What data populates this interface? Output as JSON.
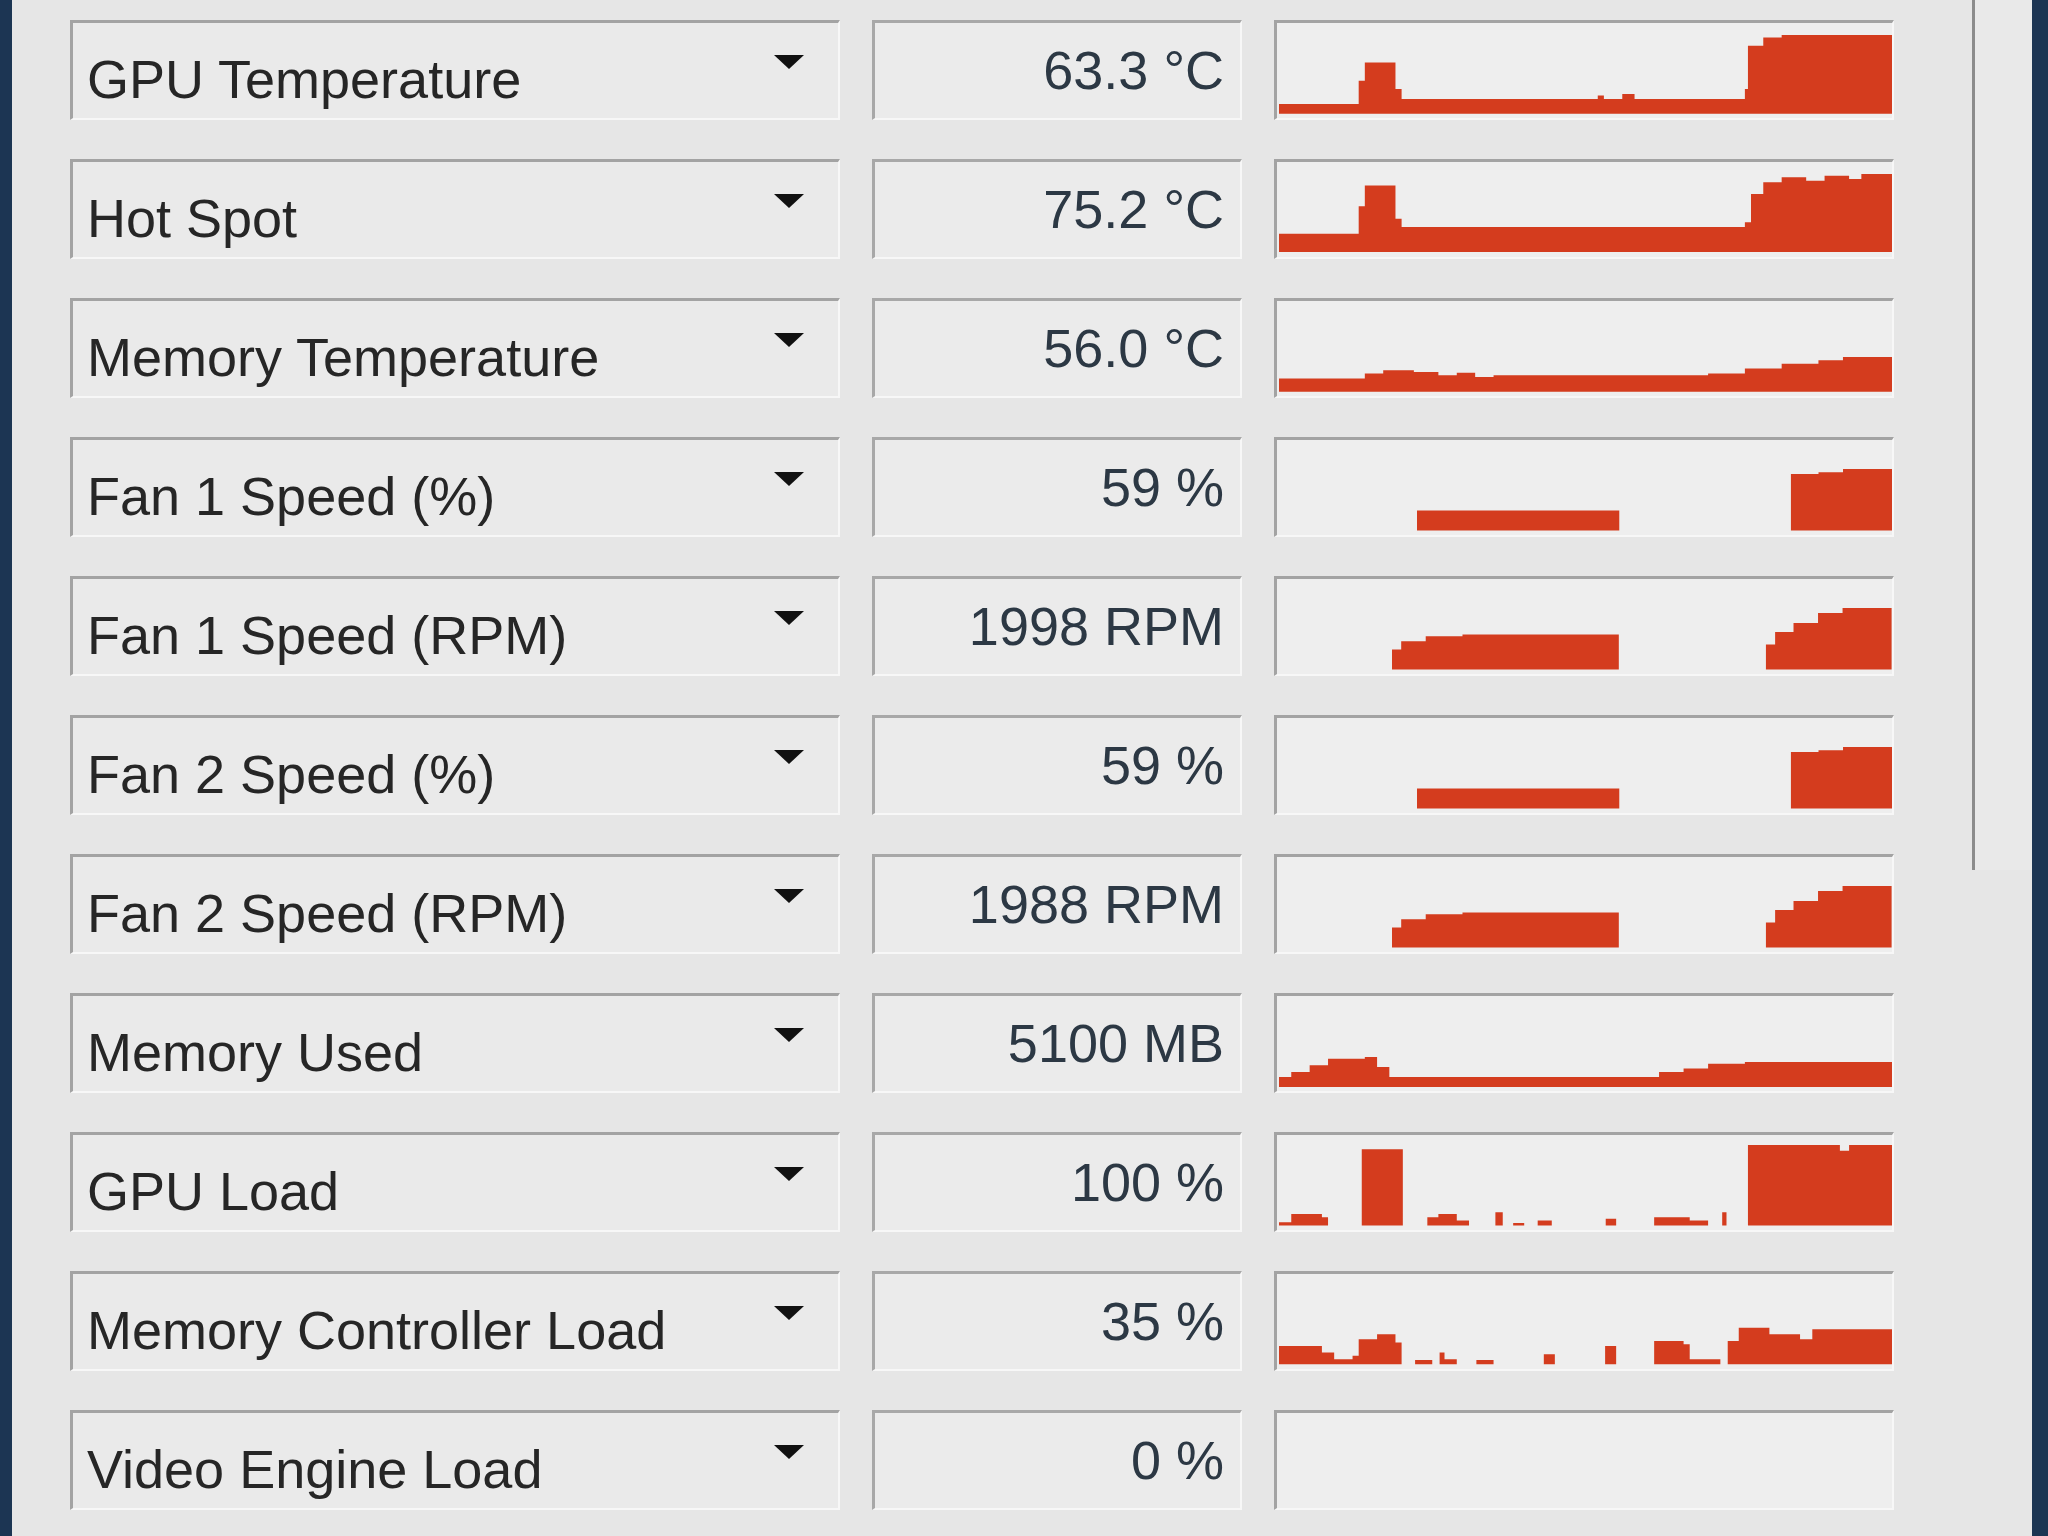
{
  "sensors": [
    {
      "name": "GPU Temperature",
      "value": "63.3 °C"
    },
    {
      "name": "Hot Spot",
      "value": "75.2 °C"
    },
    {
      "name": "Memory Temperature",
      "value": "56.0 °C"
    },
    {
      "name": "Fan 1 Speed (%)",
      "value": "59 %"
    },
    {
      "name": "Fan 1 Speed (RPM)",
      "value": "1998 RPM"
    },
    {
      "name": "Fan 2 Speed (%)",
      "value": "59 %"
    },
    {
      "name": "Fan 2 Speed (RPM)",
      "value": "1988 RPM"
    },
    {
      "name": "Memory Used",
      "value": "5100 MB"
    },
    {
      "name": "GPU Load",
      "value": "100 %"
    },
    {
      "name": "Memory Controller Load",
      "value": "35 %"
    },
    {
      "name": "Video Engine Load",
      "value": "0 %"
    }
  ]
}
